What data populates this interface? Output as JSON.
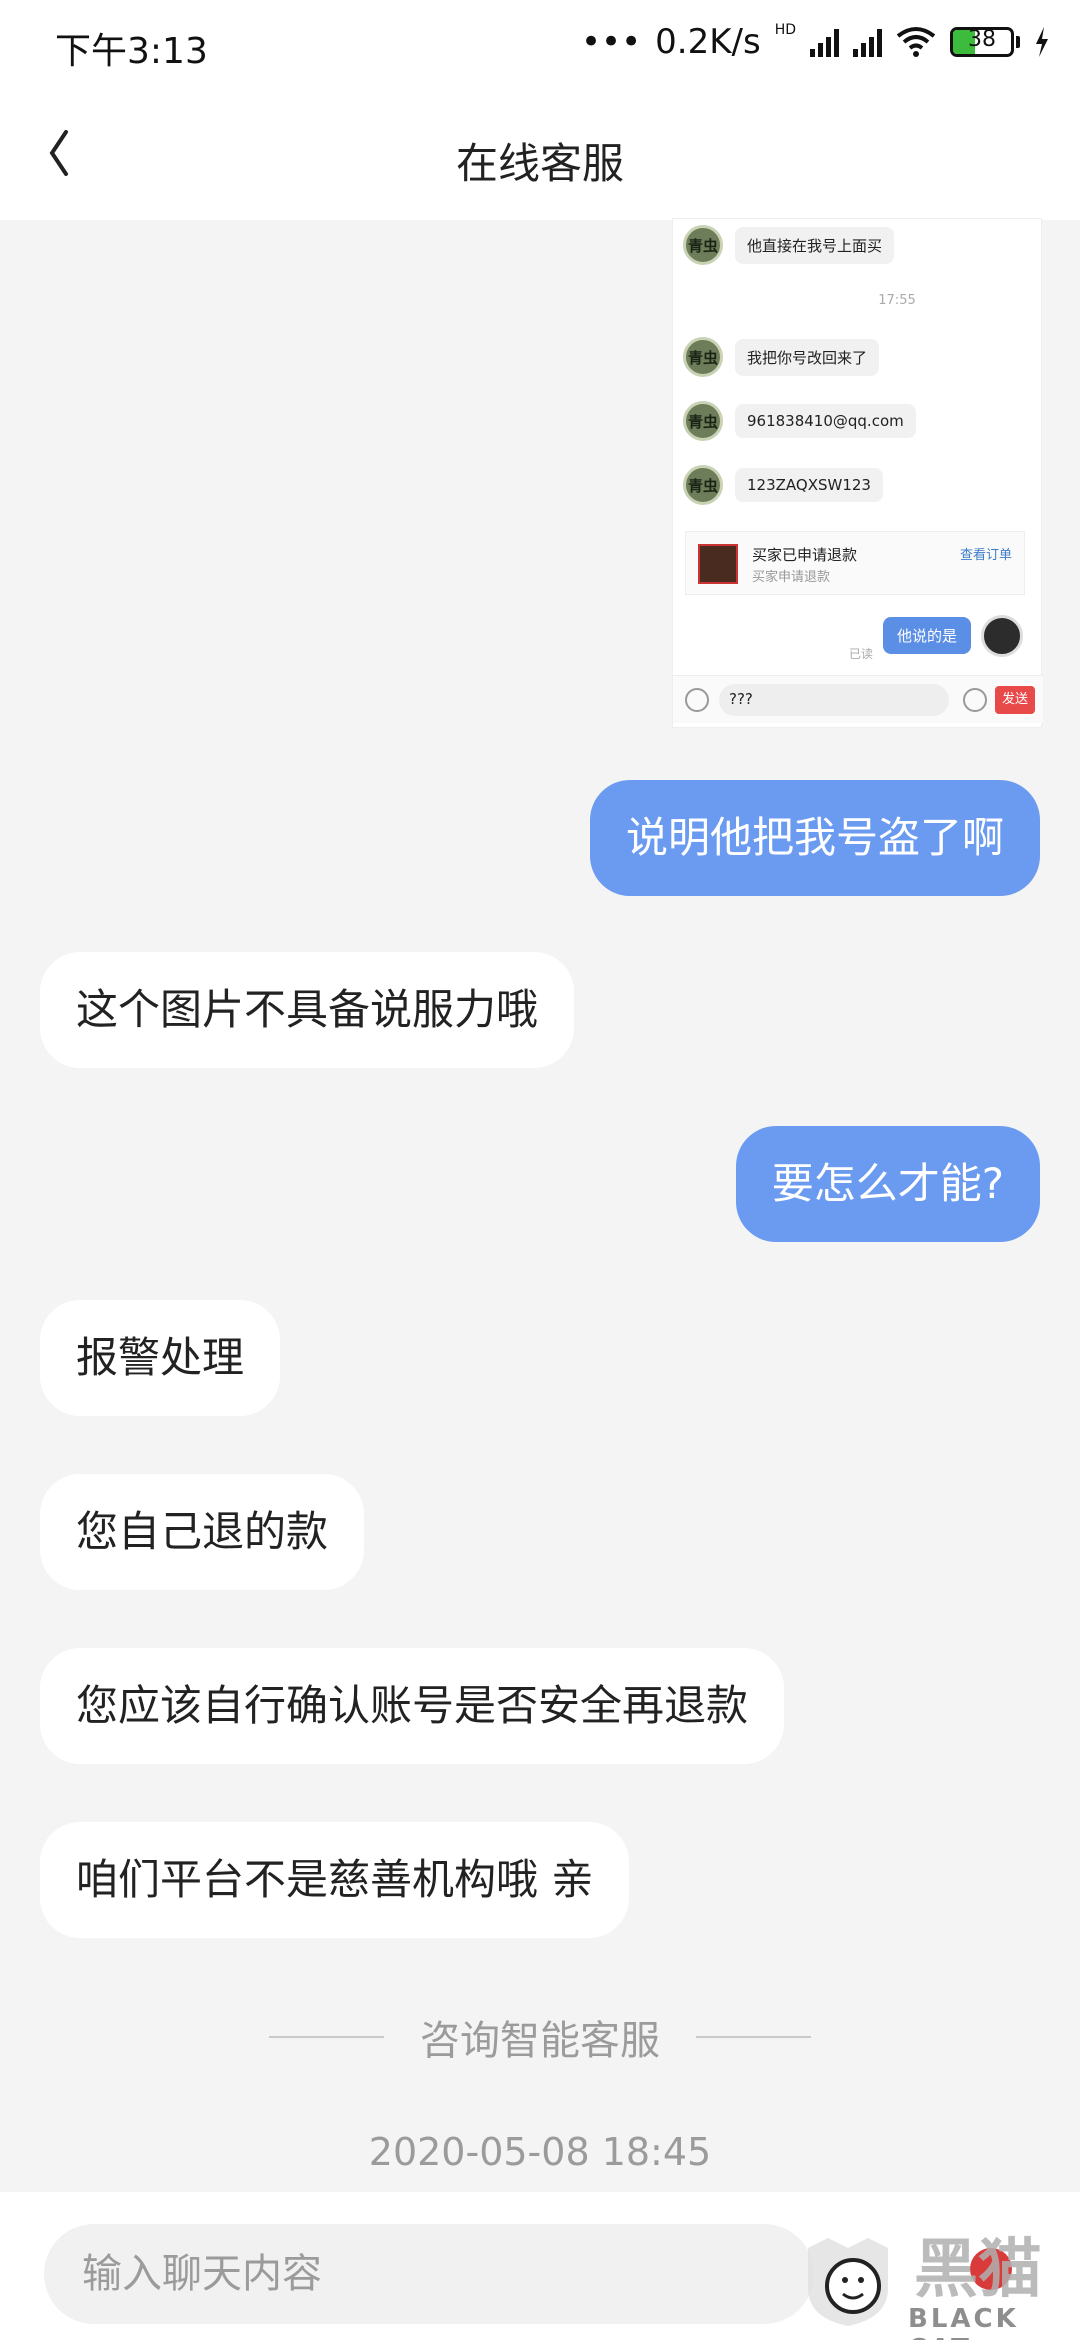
{
  "status_bar": {
    "time": "下午3:13",
    "network_speed": "0.2K/s",
    "network_type": "HD",
    "battery_level": "38",
    "battery_fraction": 0.38,
    "colors": {
      "battery_fill": "#3dbb3d"
    }
  },
  "header": {
    "title": "在线客服",
    "back_icon": "chevron-left-icon"
  },
  "embedded_screenshot": {
    "messages": [
      {
        "sender": "other",
        "avatar_text": "青虫",
        "text": "他直接在我号上面买"
      },
      {
        "sender": "system",
        "text": "17:55"
      },
      {
        "sender": "other",
        "avatar_text": "青虫",
        "text": "我把你号改回来了"
      },
      {
        "sender": "other",
        "avatar_text": "青虫",
        "text": "961838410@qq.com"
      },
      {
        "sender": "other",
        "avatar_text": "青虫",
        "text": "123ZAQXSW123"
      }
    ],
    "order_card": {
      "title": "买家已申请退款",
      "subtitle": "买家申请退款",
      "link": "查看订单"
    },
    "my_message": {
      "text": "他说的是",
      "status": "已读"
    },
    "input_value": "???",
    "send_label": "发送"
  },
  "messages": [
    {
      "sender": "me",
      "text": "说明他把我号盗了啊"
    },
    {
      "sender": "agent",
      "text": "这个图片不具备说服力哦"
    },
    {
      "sender": "me",
      "text": "要怎么才能?"
    },
    {
      "sender": "agent",
      "text": "报警处理"
    },
    {
      "sender": "agent",
      "text": "您自己退的款"
    },
    {
      "sender": "agent",
      "text": "您应该自行确认账号是否安全再退款"
    },
    {
      "sender": "agent",
      "text": "咱们平台不是慈善机构哦 亲"
    }
  ],
  "divider_text": "咨询智能客服",
  "timestamp": "2020-05-08 18:45",
  "input": {
    "placeholder": "输入聊天内容"
  },
  "watermark": {
    "text": "BLACK CAT",
    "glyphs": "黑猫"
  },
  "colors": {
    "my_bubble": "#6b9bf0",
    "their_bubble": "#ffffff",
    "background": "#f4f4f4"
  }
}
